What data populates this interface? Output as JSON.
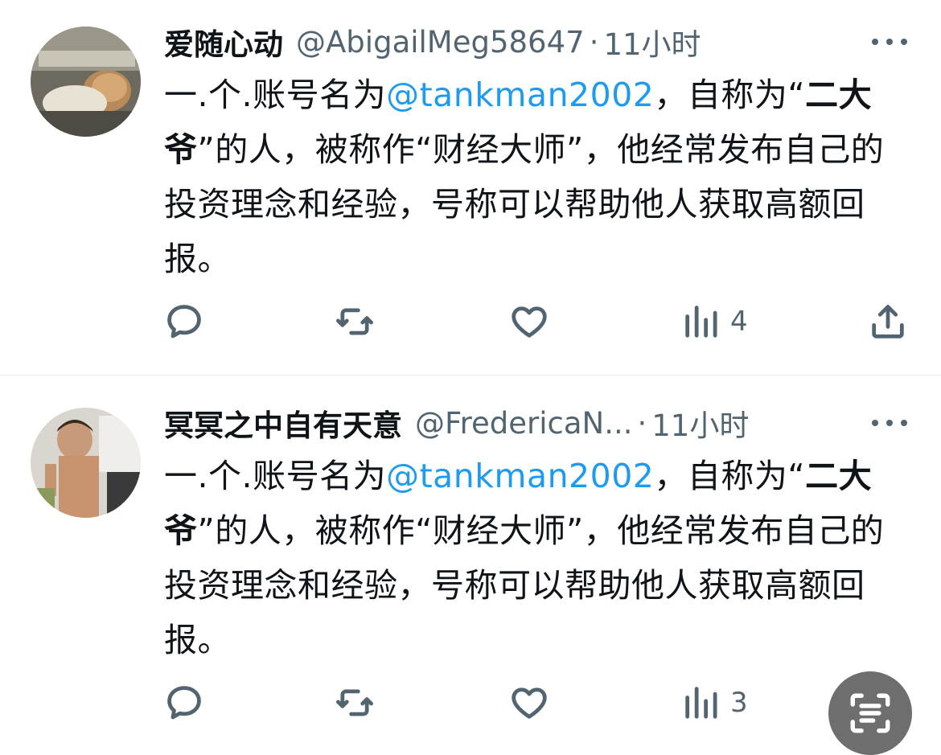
{
  "tweets": [
    {
      "display_name": "爱随心动",
      "handle": "@AbigailMeg58647",
      "separator": "·",
      "time": "11小时",
      "text": {
        "prefix": "一.个.账号名为",
        "mention": "@tankman2002",
        "after_mention": "，自称为“",
        "bold_phrase": "二大爷",
        "rest": "”的人，被称作“财经大师”，他经常发布自己的投资理念和经验，号称可以帮助他人获取高额回报。"
      },
      "actions": {
        "views_count": "4"
      }
    },
    {
      "display_name": "冥冥之中自有天意",
      "handle": "@FredericaN...",
      "separator": "·",
      "time": "11小时",
      "text": {
        "prefix": "一.个.账号名为",
        "mention": "@tankman2002",
        "after_mention": "，自称为“",
        "bold_phrase": "二大爷",
        "rest": "”的人，被称作“财经大师”，他经常发布自己的投资理念和经验，号称可以帮助他人获取高额回报。"
      },
      "actions": {
        "views_count": "3"
      }
    }
  ],
  "icons": {
    "more": "more-horizontal-icon",
    "reply": "reply-icon",
    "retweet": "retweet-icon",
    "like": "heart-icon",
    "views": "views-chart-icon",
    "share": "share-icon",
    "scan": "text-scan-icon"
  },
  "colors": {
    "text": "#0f1419",
    "secondary": "#536471",
    "mention": "#1d9bf0",
    "divider": "#e7e9ea",
    "scan_button": "#6e6e6e"
  }
}
